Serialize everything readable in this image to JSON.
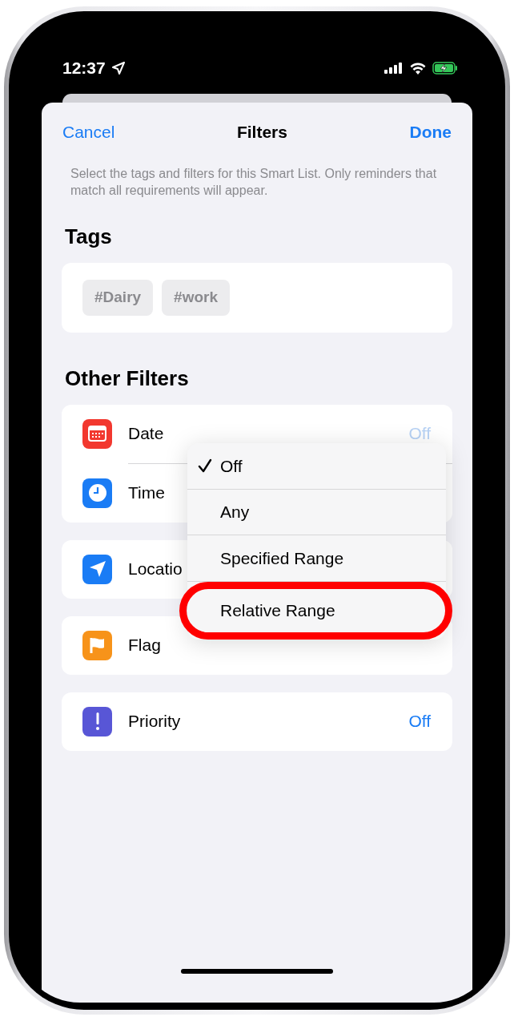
{
  "status_bar": {
    "time": "12:37"
  },
  "nav": {
    "cancel": "Cancel",
    "title": "Filters",
    "done": "Done"
  },
  "description": "Select the tags and filters for this Smart List. Only reminders that match all requirements will appear.",
  "tags_section": {
    "title": "Tags",
    "tags": [
      "#Dairy",
      "#work"
    ]
  },
  "filters_section": {
    "title": "Other Filters",
    "groups": [
      {
        "rows": [
          {
            "label": "Date",
            "color": "#f2382f",
            "value": "Off",
            "dimmed": true
          },
          {
            "label": "Time",
            "color": "#1a7cf5"
          }
        ]
      },
      {
        "rows": [
          {
            "label": "Locatio",
            "color": "#1a7cf5"
          }
        ]
      },
      {
        "rows": [
          {
            "label": "Flag",
            "color": "#f7931a"
          }
        ]
      },
      {
        "rows": [
          {
            "label": "Priority",
            "color": "#5856d6",
            "value": "Off",
            "dimmed": false
          }
        ]
      }
    ]
  },
  "menu": {
    "items": [
      {
        "label": "Off",
        "selected": true,
        "highlighted": false
      },
      {
        "label": "Any",
        "selected": false,
        "highlighted": false
      },
      {
        "label": "Specified Range",
        "selected": false,
        "highlighted": false
      },
      {
        "label": "Relative Range",
        "selected": false,
        "highlighted": true
      }
    ]
  }
}
